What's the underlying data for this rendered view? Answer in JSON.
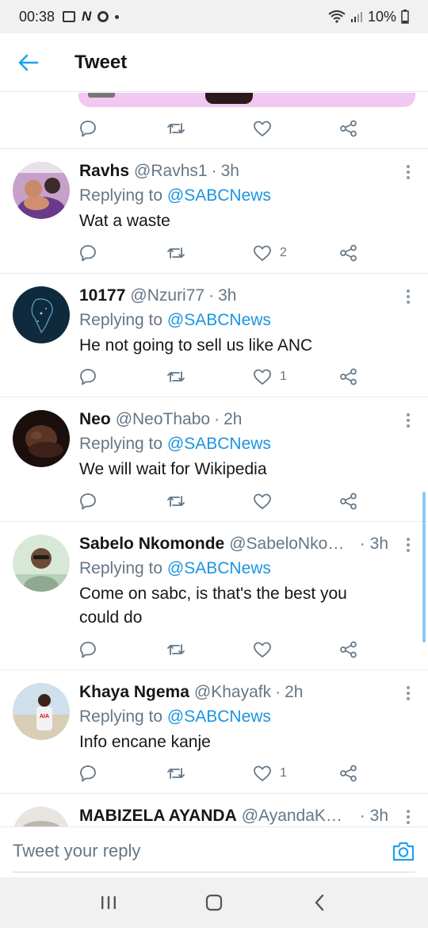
{
  "status_bar": {
    "time": "00:38",
    "battery": "10%"
  },
  "header": {
    "title": "Tweet"
  },
  "tweets": [
    {
      "name": "Ravhs",
      "handle": "@Ravhs1",
      "time": "3h",
      "replying_prefix": "Replying to",
      "replying_to": "@SABCNews",
      "text": [
        "Wat a waste"
      ],
      "likes": "2"
    },
    {
      "name": "10177",
      "handle": "@Nzuri77",
      "time": "3h",
      "replying_prefix": "Replying to",
      "replying_to": "@SABCNews",
      "text": [
        "He not going to sell us like ANC"
      ],
      "likes": "1"
    },
    {
      "name": "Neo",
      "handle": "@NeoThabo",
      "time": "2h",
      "replying_prefix": "Replying to",
      "replying_to": "@SABCNews",
      "text": [
        "We will wait for Wikipedia"
      ],
      "likes": ""
    },
    {
      "name": "Sabelo Nkomonde",
      "handle": "@SabeloNko…",
      "time": "3h",
      "replying_prefix": "Replying to",
      "replying_to": "@SABCNews",
      "text": [
        "Come on sabc, is that's the best you",
        "could do"
      ],
      "likes": ""
    },
    {
      "name": "Khaya Ngema",
      "handle": "@Khayafk",
      "time": "2h",
      "replying_prefix": "Replying to",
      "replying_to": "@SABCNews",
      "text": [
        "Info encane kanje"
      ],
      "likes": "1"
    },
    {
      "name": "MABIZELA AYANDA",
      "handle": "@AyandaK…",
      "time": "3h"
    }
  ],
  "composer": {
    "placeholder": "Tweet your reply"
  },
  "colors": {
    "accent": "#1da1f2",
    "mention": "#1b95e0",
    "muted": "#657786"
  },
  "icons": [
    "back-arrow-icon",
    "reply-icon",
    "retweet-icon",
    "heart-icon",
    "share-icon",
    "more-icon",
    "camera-icon",
    "recent-apps-icon",
    "home-icon",
    "back-nav-icon"
  ]
}
